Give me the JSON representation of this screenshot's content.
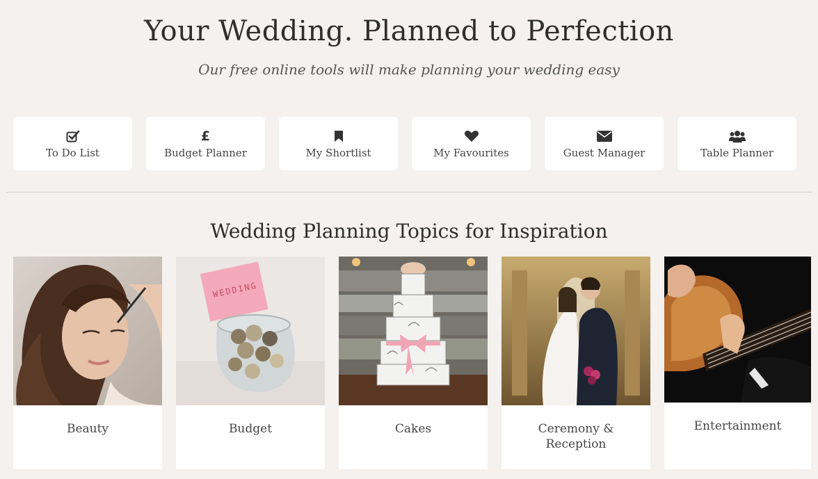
{
  "hero": {
    "title": "Your Wedding. Planned to Perfection",
    "subtitle": "Our free online tools will make planning your wedding easy"
  },
  "tools": [
    {
      "label": "To Do List",
      "icon": "checkbox-icon"
    },
    {
      "label": "Budget Planner",
      "icon": "pound-icon",
      "glyph": "£"
    },
    {
      "label": "My Shortlist",
      "icon": "bookmark-icon"
    },
    {
      "label": "My Favourites",
      "icon": "heart-icon"
    },
    {
      "label": "Guest Manager",
      "icon": "envelope-icon"
    },
    {
      "label": "Table Planner",
      "icon": "users-icon"
    }
  ],
  "topics_section": {
    "title": "Wedding Planning Topics for Inspiration"
  },
  "topics": [
    {
      "label": "Beauty"
    },
    {
      "label": "Budget"
    },
    {
      "label": "Cakes"
    },
    {
      "label_line1": "Ceremony &",
      "label_line2": "Reception"
    },
    {
      "label": "Entertainment"
    }
  ],
  "colors": {
    "background": "#f4f1ee",
    "card": "#ffffff",
    "text": "#333333"
  }
}
